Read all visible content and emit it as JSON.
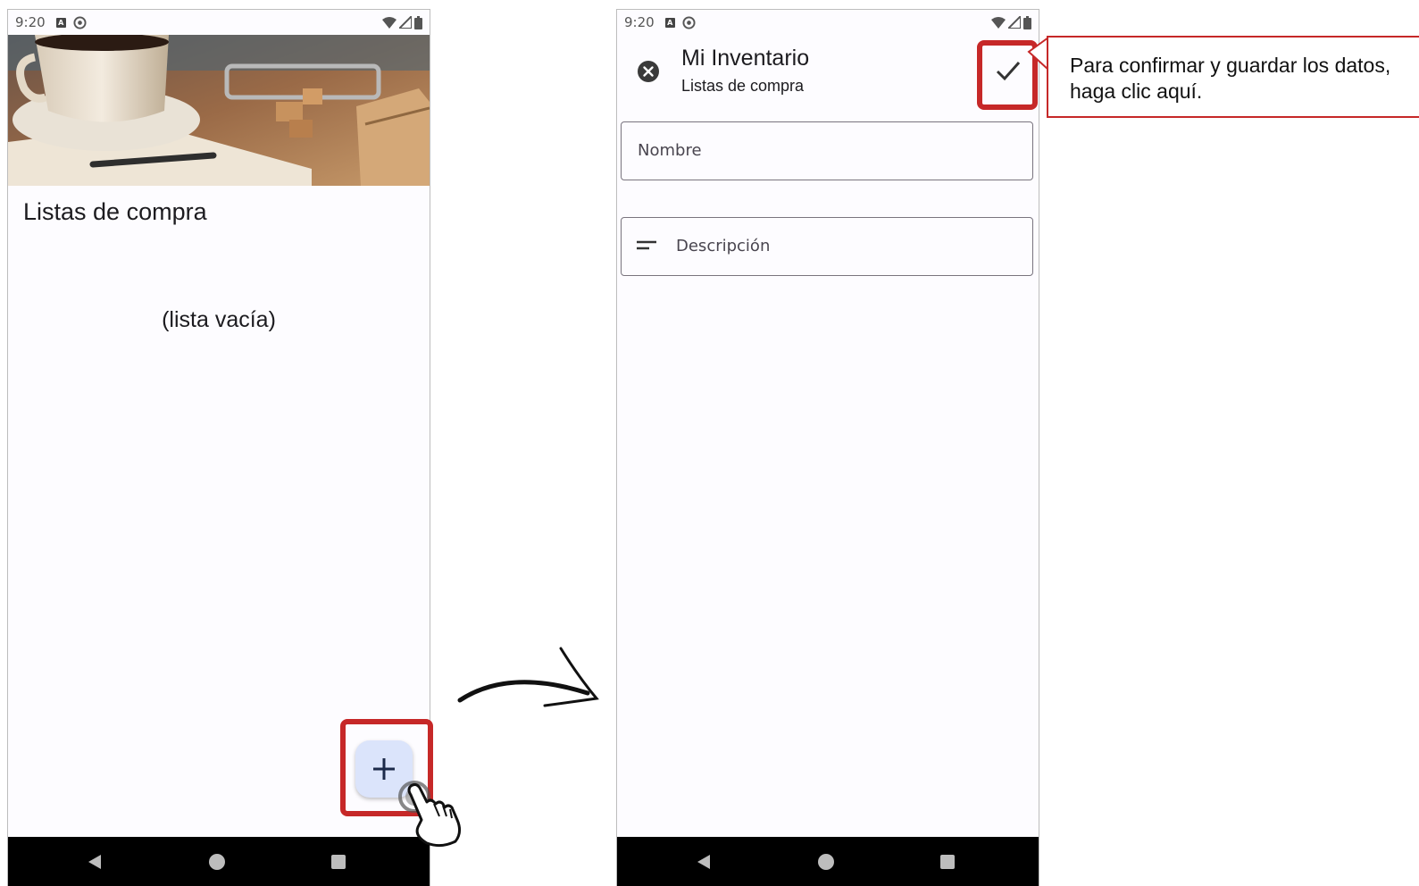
{
  "colors": {
    "highlight": "#c62828",
    "fab_background": "#dbe4fb",
    "screen_background": "#fdfcff",
    "navbar": "#000000"
  },
  "left_screen": {
    "status_bar": {
      "time": "9:20",
      "icons": [
        "a-badge-icon",
        "sync-icon",
        "wifi-icon",
        "signal-icon",
        "battery-icon"
      ]
    },
    "hero_image": "coffee-cup-and-packages-photo",
    "title": "Listas de compra",
    "empty_message": "(lista vacía)",
    "fab": {
      "icon": "plus-icon",
      "highlighted": true
    },
    "nav": [
      "back",
      "home",
      "recents"
    ]
  },
  "right_screen": {
    "status_bar": {
      "time": "9:20",
      "icons": [
        "a-badge-icon",
        "sync-icon",
        "wifi-icon",
        "signal-icon",
        "battery-icon"
      ]
    },
    "app_bar": {
      "title": "Mi Inventario",
      "subtitle": "Listas de compra",
      "close_icon": "close-circle-icon",
      "confirm_icon": "check-icon"
    },
    "fields": {
      "name_placeholder": "Nombre",
      "description_placeholder": "Descripción"
    },
    "nav": [
      "back",
      "home",
      "recents"
    ]
  },
  "annotation": {
    "callout_text": "Para confirmar y guardar los datos, haga clic aquí."
  }
}
